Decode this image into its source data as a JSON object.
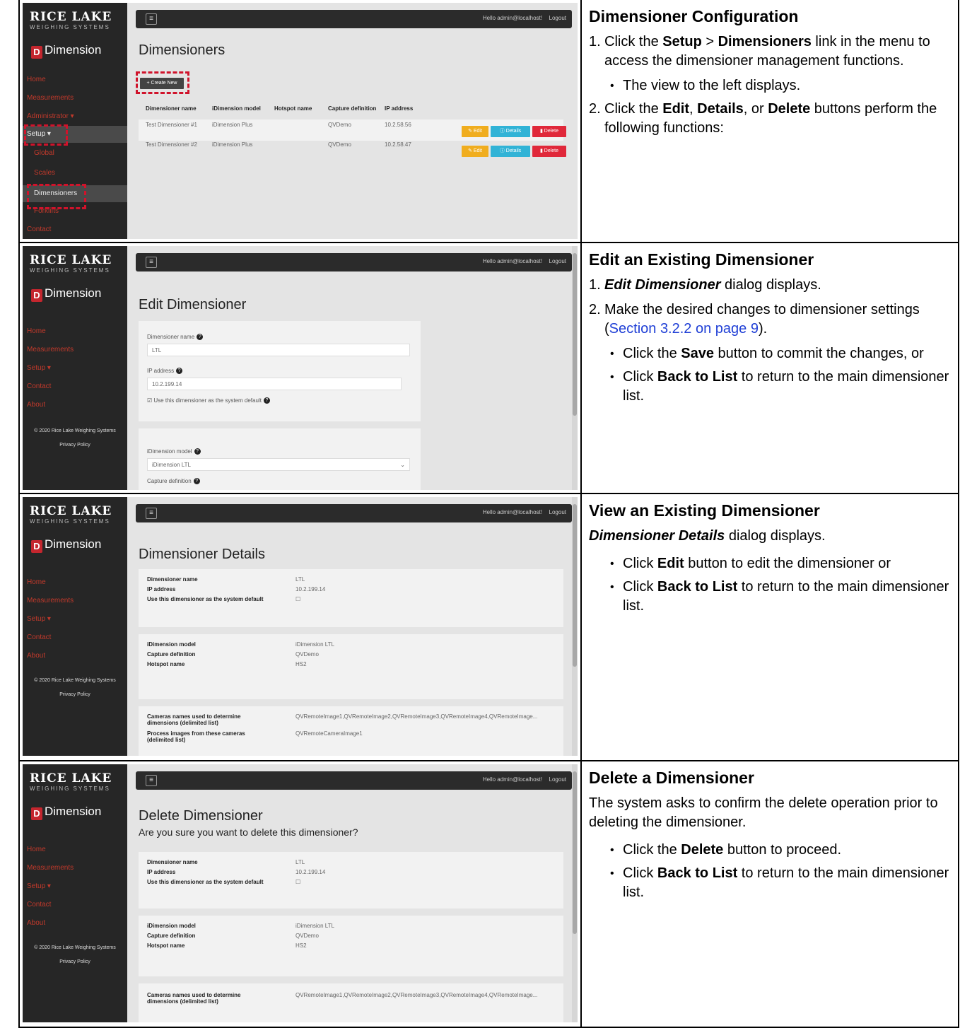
{
  "app": {
    "logo_brand": "RICE LAKE",
    "logo_sub": "WEIGHING SYSTEMS",
    "logo_product": "Dimension",
    "hello": "Hello admin@localhost!",
    "logout": "Logout",
    "copyright": "© 2020 Rice Lake Weighing Systems",
    "privacy": "Privacy Policy",
    "nav_home": "Home",
    "nav_measurements": "Measurements",
    "nav_administrator": "Administrator ▾",
    "nav_setup": "Setup ▾",
    "nav_global": "Global",
    "nav_scales": "Scales",
    "nav_dimensioners": "Dimensioners",
    "nav_forklifts": "Forklifts",
    "nav_contact": "Contact",
    "nav_about": "About"
  },
  "row1": {
    "shot": {
      "title": "Dimensioners",
      "create_new": "+ Create New",
      "columns": [
        "Dimensioner name",
        "iDimension model",
        "Hotspot name",
        "Capture definition",
        "IP address"
      ],
      "rows": [
        [
          "Test Dimensioner #1",
          "iDimension Plus",
          "",
          "QVDemo",
          "10.2.58.56"
        ],
        [
          "Test Dimensioner #2",
          "iDimension Plus",
          "",
          "QVDemo",
          "10.2.58.47"
        ]
      ],
      "btn_edit": "Edit",
      "btn_details": "Details",
      "btn_delete": "Delete"
    },
    "text": {
      "heading": "Dimensioner Configuration",
      "s1_num": "1.",
      "s1_a": "Click the ",
      "s1_b": "Setup",
      "s1_c": " > ",
      "s1_d": "Dimensioners",
      "s1_e": " link in the menu to access the dimensioner management functions.",
      "s1_bullet": "The view to the left displays.",
      "s2_num": "2.",
      "s2_a": "Click the ",
      "s2_b": "Edit",
      "s2_c": ", ",
      "s2_d": "Details",
      "s2_e": ", or ",
      "s2_f": "Delete",
      "s2_g": " buttons perform the following functions:"
    }
  },
  "row2": {
    "shot": {
      "title": "Edit Dimensioner",
      "f1_label": "Dimensioner name",
      "f1_value": "LTL",
      "f2_label": "IP address",
      "f2_value": "10.2.199.14",
      "checkbox_label": "Use this dimensioner as the system default",
      "f3_label": "iDimension model",
      "f3_value": "iDimension LTL",
      "f4_label": "Capture definition"
    },
    "text": {
      "heading": "Edit an Existing Dimensioner",
      "s1_num": "1.",
      "s1_a": "Edit Dimensioner",
      "s1_b": " dialog displays.",
      "s2_num": "2.",
      "s2_a": "Make the desired changes to dimensioner settings (",
      "s2_link": "Section 3.2.2 on page 9",
      "s2_b": ").",
      "b1_a": "Click the ",
      "b1_b": "Save",
      "b1_c": " button to commit the changes, or",
      "b2_a": "Click ",
      "b2_b": "Back to List",
      "b2_c": " to return to the main dimensioner list."
    }
  },
  "row3": {
    "shot": {
      "title": "Dimensioner Details",
      "k1": "Dimensioner name",
      "v1": "LTL",
      "k2": "IP address",
      "v2": "10.2.199.14",
      "k3": "Use this dimensioner as the system default",
      "v3": "☐",
      "k4": "iDimension model",
      "v4": "iDimension LTL",
      "k5": "Capture definition",
      "v5": "QVDemo",
      "k6": "Hotspot name",
      "v6": "HS2",
      "k7": "Cameras names used to determine dimensions (delimited list)",
      "v7": "QVRemoteImage1,QVRemoteImage2,QVRemoteImage3,QVRemoteImage4,QVRemoteImage...",
      "k8": "Process images from these cameras (delimited list)",
      "v8": "QVRemoteCameraImage1"
    },
    "text": {
      "heading": "View an Existing Dimensioner",
      "intro_a": "Dimensioner Details",
      "intro_b": " dialog displays.",
      "b1_a": "Click ",
      "b1_b": "Edit",
      "b1_c": " button to edit the dimensioner or",
      "b2_a": "Click ",
      "b2_b": "Back to List",
      "b2_c": " to return to the main dimensioner list."
    }
  },
  "row4": {
    "shot": {
      "title": "Delete Dimensioner",
      "question": "Are you sure you want to delete this dimensioner?",
      "k1": "Dimensioner name",
      "v1": "LTL",
      "k2": "IP address",
      "v2": "10.2.199.14",
      "k3": "Use this dimensioner as the system default",
      "v3": "☐",
      "k4": "iDimension model",
      "v4": "iDimension LTL",
      "k5": "Capture definition",
      "v5": "QVDemo",
      "k6": "Hotspot name",
      "v6": "HS2",
      "k7": "Cameras names used to determine dimensions (delimited list)",
      "v7": "QVRemoteImage1,QVRemoteImage2,QVRemoteImage3,QVRemoteImage4,QVRemoteImage..."
    },
    "text": {
      "heading": "Delete a Dimensioner",
      "intro": "The system asks to confirm the delete operation prior to deleting the dimensioner.",
      "b1_a": "Click the ",
      "b1_b": "Delete",
      "b1_c": " button to proceed.",
      "b2_a": "Click ",
      "b2_b": "Back to List",
      "b2_c": " to return to the main dimensioner list."
    }
  },
  "colors": {
    "brand_red": "#c4262e",
    "highlight_red": "#d0132b",
    "edit_btn": "#f0ad1e",
    "details_btn": "#31b3d6",
    "delete_btn": "#e0283a",
    "link": "#1f3fd6"
  }
}
